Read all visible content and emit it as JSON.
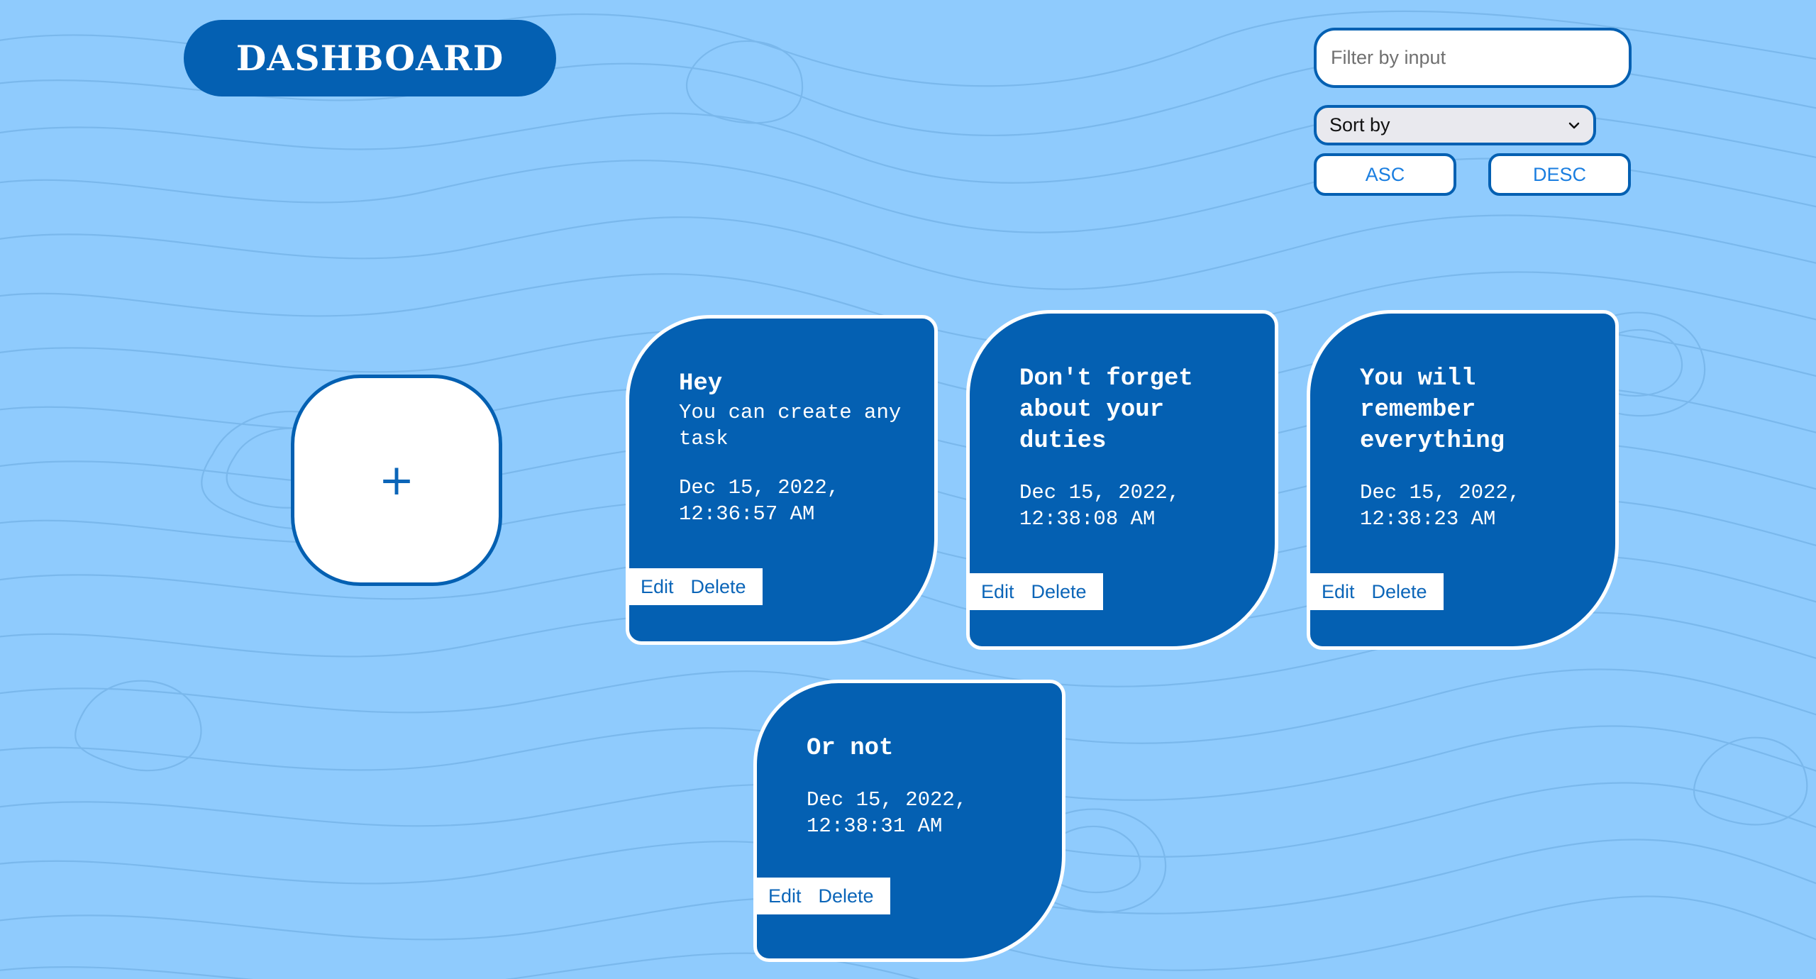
{
  "header": {
    "title": "DASHBOARD"
  },
  "controls": {
    "filter_placeholder": "Filter by input",
    "sort_label": "Sort by",
    "asc_label": "ASC",
    "desc_label": "DESC"
  },
  "add_task": {
    "label": "+"
  },
  "tasks": [
    {
      "title": "Hey",
      "description": "You can create any task",
      "date": "Dec 15, 2022,\n12:36:57 AM",
      "edit_label": "Edit",
      "delete_label": "Delete"
    },
    {
      "title": "Don't forget about your duties",
      "description": "",
      "date": "Dec 15, 2022,\n12:38:08 AM",
      "edit_label": "Edit",
      "delete_label": "Delete"
    },
    {
      "title": "You will remember everything",
      "description": "",
      "date": "Dec 15, 2022,\n12:38:23 AM",
      "edit_label": "Edit",
      "delete_label": "Delete"
    },
    {
      "title": "Or not",
      "description": "",
      "date": "Dec 15, 2022,\n12:38:31 AM",
      "edit_label": "Edit",
      "delete_label": "Delete"
    }
  ],
  "colors": {
    "background": "#8fcbfd",
    "contour": "#7ab8ec",
    "primary": "#0460b2",
    "link": "#1a7ee0",
    "card_text": "#ffffff"
  }
}
